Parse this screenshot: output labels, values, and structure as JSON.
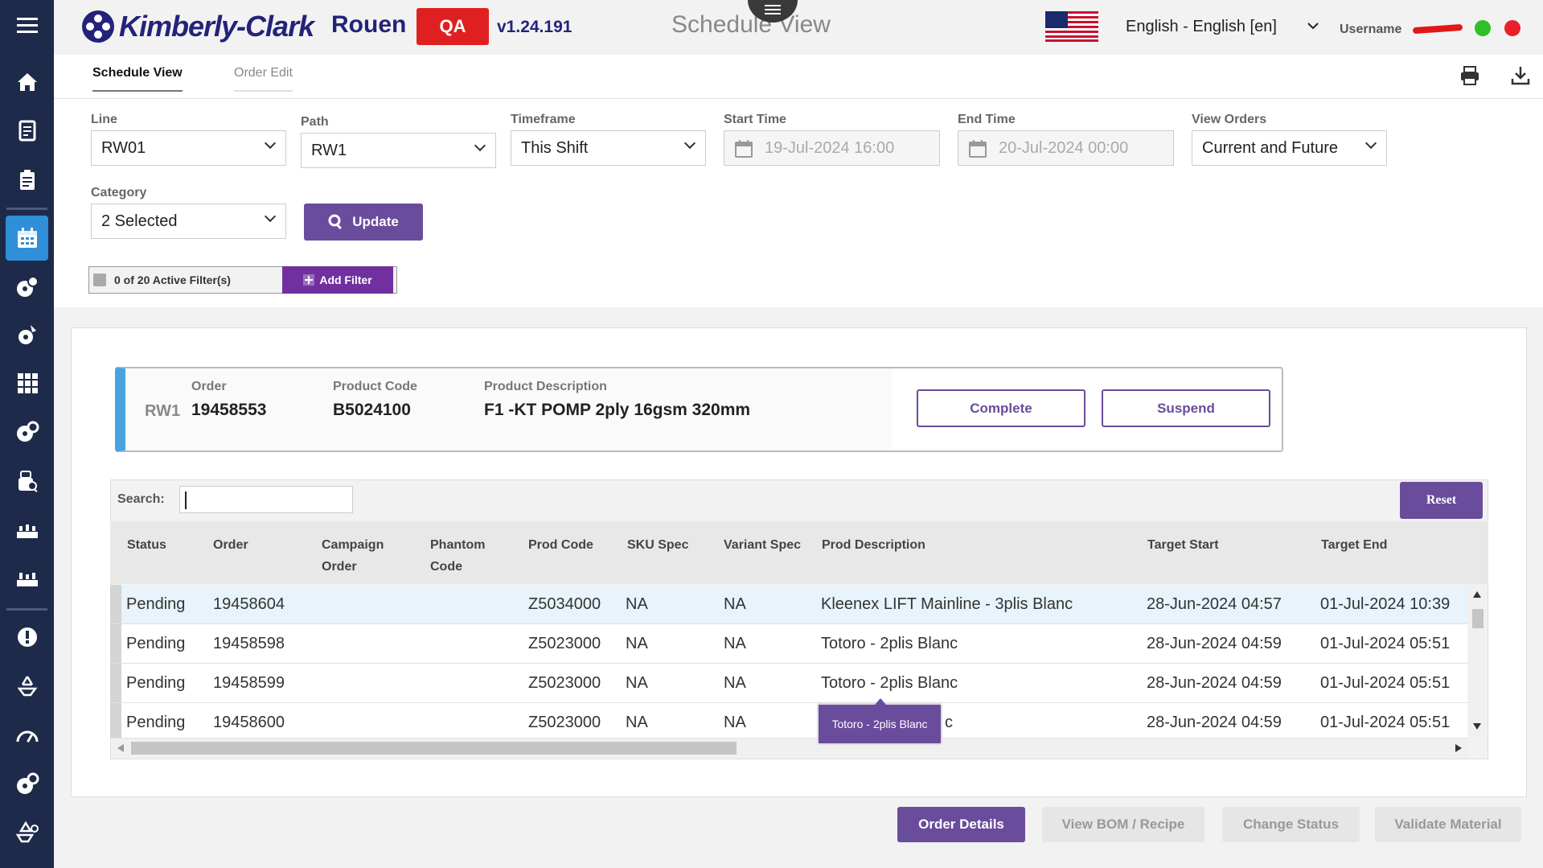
{
  "header": {
    "logo_text": "Kimberly-Clark",
    "site": "Rouen",
    "env_badge": "QA",
    "version": "v1.24.191",
    "page_title": "Schedule View",
    "language": "English - English [en]",
    "username": "Username",
    "status_colors": {
      "ok": "#2ec026",
      "alert": "#e8202a"
    }
  },
  "tabs": [
    {
      "label": "Schedule View",
      "active": true
    },
    {
      "label": "Order Edit",
      "active": false
    }
  ],
  "filters": {
    "line": {
      "label": "Line",
      "value": "RW01"
    },
    "path": {
      "label": "Path",
      "value": "RW1"
    },
    "timeframe": {
      "label": "Timeframe",
      "value": "This Shift"
    },
    "start_time": {
      "label": "Start Time",
      "value": "19-Jul-2024 16:00"
    },
    "end_time": {
      "label": "End Time",
      "value": "20-Jul-2024 00:00"
    },
    "view_orders": {
      "label": "View Orders",
      "value": "Current and Future"
    },
    "category": {
      "label": "Category",
      "value": "2 Selected"
    },
    "update_label": "Update",
    "active_filters": "0 of 20 Active Filter(s)",
    "add_filter_label": "Add Filter"
  },
  "current_order": {
    "line": "RW1",
    "order_label": "Order",
    "order": "19458553",
    "product_code_label": "Product Code",
    "product_code": "B5024100",
    "product_description_label": "Product Description",
    "product_description": "F1 -KT POMP 2ply 16gsm 320mm",
    "complete_label": "Complete",
    "suspend_label": "Suspend"
  },
  "table": {
    "search_label": "Search:",
    "search_value": "",
    "reset_label": "Reset",
    "columns": {
      "status": "Status",
      "order": "Order",
      "campaign_1": "Campaign",
      "campaign_2": "Order",
      "phantom_1": "Phantom",
      "phantom_2": "Code",
      "prod_code": "Prod Code",
      "sku_spec": "SKU Spec",
      "variant_spec": "Variant Spec",
      "prod_description": "Prod Description",
      "target_start": "Target Start",
      "target_end": "Target End"
    },
    "rows": [
      {
        "status": "Pending",
        "order": "19458604",
        "prod_code": "Z5034000",
        "sku_spec": "NA",
        "variant_spec": "NA",
        "prod_description": "Kleenex LIFT Mainline - 3plis Blanc",
        "target_start": "28-Jun-2024 04:57",
        "target_end": "01-Jul-2024 10:39"
      },
      {
        "status": "Pending",
        "order": "19458598",
        "prod_code": "Z5023000",
        "sku_spec": "NA",
        "variant_spec": "NA",
        "prod_description": "Totoro - 2plis Blanc",
        "target_start": "28-Jun-2024 04:59",
        "target_end": "01-Jul-2024 05:51"
      },
      {
        "status": "Pending",
        "order": "19458599",
        "prod_code": "Z5023000",
        "sku_spec": "NA",
        "variant_spec": "NA",
        "prod_description": "Totoro - 2plis Blanc",
        "target_start": "28-Jun-2024 04:59",
        "target_end": "01-Jul-2024 05:51"
      },
      {
        "status": "Pending",
        "order": "19458600",
        "prod_code": "Z5023000",
        "sku_spec": "NA",
        "variant_spec": "NA",
        "prod_description": "c",
        "target_start": "28-Jun-2024 04:59",
        "target_end": "01-Jul-2024 05:51"
      }
    ],
    "tooltip": "Totoro - 2plis Blanc"
  },
  "actions": {
    "order_details": "Order Details",
    "view_bom": "View BOM / Recipe",
    "change_status": "Change Status",
    "validate_material": "Validate Material"
  },
  "nav_icons": [
    "menu-icon",
    "home-icon",
    "orders-icon",
    "clipboard-icon",
    "calendar-icon",
    "production-icon",
    "quality-icon",
    "grid-icon",
    "settings-search-icon",
    "inspect-icon",
    "line-icon",
    "line-alt-icon",
    "alert-icon",
    "recycle-icon",
    "gauge-icon",
    "config-icon",
    "recycle-settings-icon"
  ]
}
